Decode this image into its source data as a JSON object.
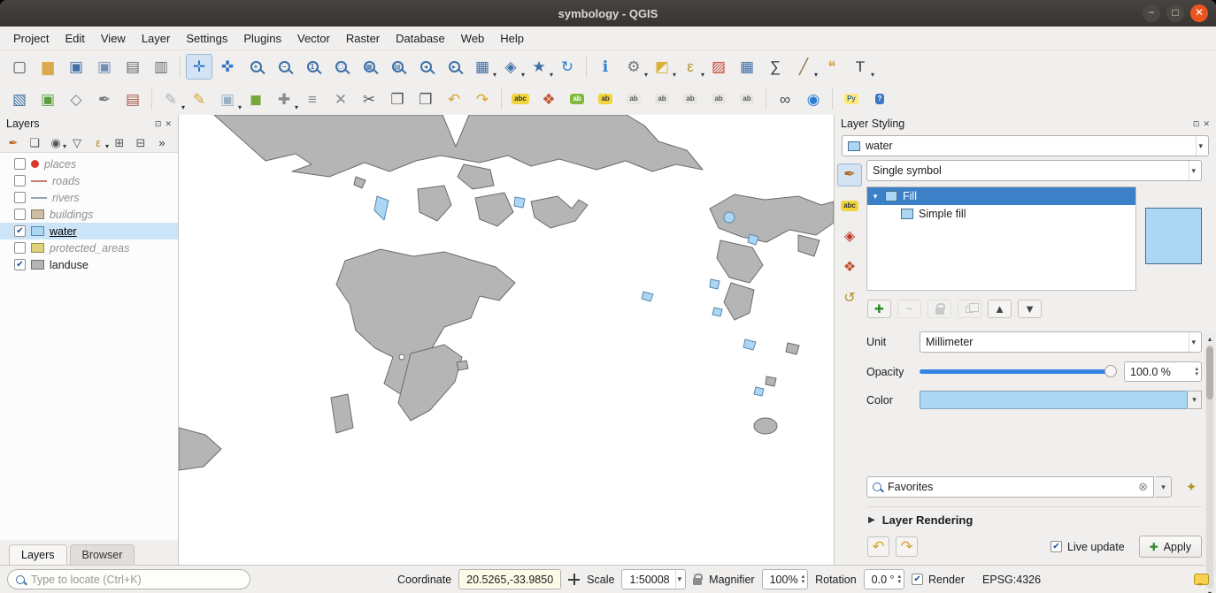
{
  "window": {
    "title": "symbology - QGIS",
    "controls": [
      {
        "type": "minimize",
        "glyph": "−"
      },
      {
        "type": "maximize",
        "glyph": "□"
      },
      {
        "type": "close",
        "glyph": "✕"
      }
    ]
  },
  "glyphs": {
    "dropdown": "▾",
    "spin_up": "▴",
    "spin_down": "▾",
    "check": "✔",
    "float": "⊡",
    "close": "✕",
    "clear": "⊗",
    "collapsed": "▶",
    "tree_expanded": "▾",
    "plus": "✚",
    "overflow": "»"
  },
  "colors": {
    "landuse_fill": "#b5b5b5",
    "landuse_stroke": "#6b6b6b",
    "water_fill": "#abd7f5",
    "water_stroke": "#5c87ab",
    "selection_blue": "#3c80c7"
  },
  "menubar": {
    "items": [
      "Project",
      "Edit",
      "View",
      "Layer",
      "Settings",
      "Plugins",
      "Vector",
      "Raster",
      "Database",
      "Web",
      "Help"
    ]
  },
  "toolbars": {
    "row1": [
      {
        "n": "new-project-button",
        "g": "▢",
        "c": "#4a4a4a"
      },
      {
        "n": "open-project-button",
        "g": "▆",
        "c": "#dba94e"
      },
      {
        "n": "save-project-button",
        "g": "▣",
        "c": "#3f6fa5"
      },
      {
        "n": "save-project-as-button",
        "g": "▣",
        "c": "#6f8fb5"
      },
      {
        "n": "new-print-layout-button",
        "g": "▤",
        "c": "#6a6a6a"
      },
      {
        "n": "show-layout-manager-button",
        "g": "▥",
        "c": "#6a6a6a"
      },
      {
        "t": "sep"
      },
      {
        "n": "pan-map-button",
        "g": "✛",
        "c": "#2f6fc4",
        "on": true
      },
      {
        "n": "pan-to-selection-button",
        "g": "✜",
        "c": "#2f6fc4"
      },
      {
        "n": "zoom-in-button",
        "t": "mag",
        "sub": "+"
      },
      {
        "n": "zoom-out-button",
        "t": "mag",
        "sub": "−"
      },
      {
        "n": "zoom-native-button",
        "t": "mag",
        "sub": "1"
      },
      {
        "n": "zoom-full-button",
        "t": "mag",
        "sub": "□"
      },
      {
        "n": "zoom-to-selection-button",
        "t": "mag",
        "sub": "▦"
      },
      {
        "n": "zoom-to-layer-button",
        "t": "mag",
        "sub": "▤"
      },
      {
        "n": "zoom-last-button",
        "t": "mag",
        "sub": "◂"
      },
      {
        "n": "zoom-next-button",
        "t": "mag",
        "sub": "▸"
      },
      {
        "n": "new-map-view-button",
        "g": "▦",
        "c": "#3f6fa5",
        "dd": true
      },
      {
        "n": "new-3d-map-view-button",
        "g": "◈",
        "c": "#3f6fa5",
        "dd": true
      },
      {
        "n": "show-bookmarks-button",
        "g": "★",
        "c": "#3f6fa5",
        "dd": true
      },
      {
        "n": "refresh-map-button",
        "g": "↻",
        "c": "#2d7dd2"
      },
      {
        "t": "sep"
      },
      {
        "n": "identify-features-button",
        "g": "ℹ",
        "c": "#2d7dd2"
      },
      {
        "n": "run-feature-action-button",
        "g": "⚙",
        "c": "#777777",
        "dd": true
      },
      {
        "n": "select-features-button",
        "g": "◩",
        "c": "#d9b23a",
        "dd": true
      },
      {
        "n": "select-by-expression-button",
        "g": "ε",
        "c": "#b5912c",
        "dd": true
      },
      {
        "n": "deselect-features-button",
        "g": "▨",
        "c": "#c74634"
      },
      {
        "n": "open-attribute-table-button",
        "g": "▦",
        "c": "#3f6fa5"
      },
      {
        "n": "statistical-summary-button",
        "g": "∑",
        "c": "#333333"
      },
      {
        "n": "measure-button",
        "g": "╱",
        "c": "#8a6d3b",
        "dd": true
      },
      {
        "n": "map-tips-button",
        "g": "❝",
        "c": "#d9a441"
      },
      {
        "n": "text-annotation-button",
        "g": "T",
        "c": "#333333",
        "dd": true
      }
    ],
    "row2": [
      {
        "n": "data-source-manager-button",
        "g": "▧",
        "c": "#3f6fa5"
      },
      {
        "n": "new-geopackage-layer-button",
        "g": "▣",
        "c": "#5a9e3c"
      },
      {
        "n": "new-shapefile-layer-button",
        "g": "◇",
        "c": "#7a7a7a"
      },
      {
        "n": "new-spatialite-layer-button",
        "g": "✒",
        "c": "#7a7a7a"
      },
      {
        "n": "new-virtual-layer-button",
        "g": "▤",
        "c": "#a85a4a"
      },
      {
        "t": "sep"
      },
      {
        "n": "current-edits-button",
        "g": "✎",
        "c": "#b0b0b0",
        "dd": true
      },
      {
        "n": "toggle-editing-button",
        "g": "✎",
        "c": "#d9a62e"
      },
      {
        "n": "save-layer-edits-button",
        "g": "▣",
        "c": "#9ab0c4",
        "dd": true
      },
      {
        "n": "add-polygon-feature-button",
        "g": "◼",
        "c": "#76a63c"
      },
      {
        "n": "vertex-tool-button",
        "g": "✚",
        "c": "#8a8a8a",
        "dd": true
      },
      {
        "n": "modify-attributes-button",
        "g": "≡",
        "c": "#8a8a8a"
      },
      {
        "n": "delete-selected-button",
        "g": "✕",
        "c": "#8a8a8a"
      },
      {
        "n": "cut-features-button",
        "g": "✂",
        "c": "#555555"
      },
      {
        "n": "copy-features-button",
        "g": "❐",
        "c": "#555555"
      },
      {
        "n": "paste-features-button",
        "g": "❒",
        "c": "#555555"
      },
      {
        "n": "undo-button",
        "g": "↶",
        "c": "#d9a62e"
      },
      {
        "n": "redo-button",
        "g": "↷",
        "c": "#d9a62e"
      },
      {
        "t": "sep"
      },
      {
        "n": "layer-labeling-button",
        "t": "badge",
        "g": "abc",
        "b": "#f2d43c",
        "c": "#333333"
      },
      {
        "n": "layer-diagram-button",
        "g": "❖",
        "c": "#c0532f"
      },
      {
        "n": "highlight-pinned-labels-button",
        "t": "badge",
        "g": "ab",
        "b": "#7fba3d",
        "c": "#ffffff"
      },
      {
        "n": "change-label-button",
        "t": "badge",
        "g": "ab",
        "b": "#f2d43c",
        "c": "#333333"
      },
      {
        "n": "pin-unpin-labels-button",
        "t": "badge",
        "g": "ab",
        "b": "#e8e6e3",
        "c": "#555555"
      },
      {
        "n": "show-hide-labels-button",
        "t": "badge",
        "g": "ab",
        "b": "#e8e6e3",
        "c": "#555555"
      },
      {
        "n": "move-label-button",
        "t": "badge",
        "g": "ab",
        "b": "#e8e6e3",
        "c": "#555555"
      },
      {
        "n": "rotate-label-button",
        "t": "badge",
        "g": "ab",
        "b": "#e8e6e3",
        "c": "#555555"
      },
      {
        "n": "change-label-properties-button",
        "t": "badge",
        "g": "ab",
        "b": "#e8e6e3",
        "c": "#555555"
      },
      {
        "t": "sep"
      },
      {
        "n": "nominatim-search-button",
        "g": "∞",
        "c": "#444444"
      },
      {
        "n": "metasearch-button",
        "g": "◉",
        "c": "#2d7dd2"
      },
      {
        "t": "sep"
      },
      {
        "n": "python-console-button",
        "t": "badge",
        "g": "Py",
        "b": "#ffe873",
        "c": "#356fa0"
      },
      {
        "n": "help-button",
        "t": "badge",
        "g": "?",
        "b": "#3a77c2",
        "c": "#ffffff"
      }
    ]
  },
  "layers_panel": {
    "title": "Layers",
    "toolbar": [
      {
        "n": "open-layer-styling-panel-button",
        "g": "✒",
        "c": "#b5651d"
      },
      {
        "n": "add-group-button",
        "g": "❏",
        "c": "#555555"
      },
      {
        "n": "manage-map-themes-button",
        "g": "◉",
        "c": "#555555",
        "dd": true
      },
      {
        "n": "filter-legend-button",
        "g": "▽",
        "c": "#555555"
      },
      {
        "n": "filter-by-expression-button",
        "g": "ε",
        "c": "#b5912c",
        "dd": true
      },
      {
        "n": "expand-all-button",
        "g": "⊞",
        "c": "#555555"
      },
      {
        "n": "collapse-all-button",
        "g": "⊟",
        "c": "#555555"
      },
      {
        "n": "toolbar-overflow-button",
        "g": "»",
        "c": "#333333"
      }
    ],
    "items": [
      {
        "label": "places",
        "checked": false,
        "italic": true,
        "selected": false,
        "swatch": {
          "type": "dot",
          "color": "#d63a2f"
        }
      },
      {
        "label": "roads",
        "checked": false,
        "italic": true,
        "selected": false,
        "swatch": {
          "type": "line",
          "color": "#c97b72"
        }
      },
      {
        "label": "rivers",
        "checked": false,
        "italic": true,
        "selected": false,
        "swatch": {
          "type": "line",
          "color": "#94a7b7"
        }
      },
      {
        "label": "buildings",
        "checked": false,
        "italic": true,
        "selected": false,
        "swatch": {
          "type": "rect",
          "color": "#cdbda5",
          "border": "#8a7b63"
        }
      },
      {
        "label": "water",
        "checked": true,
        "italic": false,
        "selected": true,
        "swatch": {
          "type": "rect",
          "color": "#abd7f5",
          "border": "#5c87ab"
        }
      },
      {
        "label": "protected_areas",
        "checked": false,
        "italic": true,
        "selected": false,
        "swatch": {
          "type": "rect",
          "color": "#ded27a",
          "border": "#9a8f4a"
        }
      },
      {
        "label": "landuse",
        "checked": true,
        "italic": false,
        "selected": false,
        "swatch": {
          "type": "rect",
          "color": "#b5b5b5",
          "border": "#6e6e6e"
        }
      }
    ],
    "tabs": [
      "Layers",
      "Browser"
    ]
  },
  "styling_panel": {
    "title": "Layer Styling",
    "layer_combo": {
      "value": "water"
    },
    "renderer_combo": "Single symbol",
    "side_tabs": [
      {
        "n": "symbology-tab-button",
        "g": "✒",
        "c": "#b5651d",
        "on": true
      },
      {
        "n": "labels-tab-button",
        "t": "badge",
        "g": "abc",
        "b": "#f2d43c",
        "c": "#333333"
      },
      {
        "n": "3d-view-tab-button",
        "g": "◈",
        "c": "#c0392b"
      },
      {
        "n": "diagrams-tab-button",
        "g": "❖",
        "c": "#c0532f"
      },
      {
        "n": "history-tab-button",
        "g": "↺",
        "c": "#b5912c"
      }
    ],
    "symbol_tree": {
      "root_label": "Fill",
      "child_label": "Simple fill"
    },
    "symbol_buttons": [
      {
        "n": "add-symbol-layer-button",
        "g": "✚",
        "c": "#2e8b2e"
      },
      {
        "n": "remove-symbol-layer-button",
        "g": "−",
        "c": "#555555",
        "dis": true
      },
      {
        "n": "lock-symbol-layer-button",
        "t": "lock",
        "dis": true
      },
      {
        "n": "duplicate-symbol-layer-button",
        "t": "dup",
        "dis": true
      },
      {
        "n": "move-symbol-up-button",
        "g": "▲",
        "c": "#444444"
      },
      {
        "n": "move-symbol-down-button",
        "g": "▼",
        "c": "#444444"
      }
    ],
    "properties": {
      "unit_label": "Unit",
      "unit_value": "Millimeter",
      "opacity_label": "Opacity",
      "opacity_value": "100.0 %",
      "color_label": "Color"
    },
    "favorites": {
      "value": "Favorites"
    },
    "layer_rendering": {
      "label": "Layer Rendering"
    },
    "footer": {
      "history_buttons": [
        {
          "n": "style-undo-button",
          "g": "↶",
          "c": "#d9a62e"
        },
        {
          "n": "style-redo-button",
          "g": "↷",
          "c": "#d9a62e"
        }
      ],
      "live_update_label": "Live update",
      "apply_label": "Apply"
    }
  },
  "statusbar": {
    "locate_placeholder": "Type to locate (Ctrl+K)",
    "coordinate_label": "Coordinate",
    "coordinate_value": "20.5265,-33.9850",
    "scale_label": "Scale",
    "scale_value": "1:50008",
    "magnifier_label": "Magnifier",
    "magnifier_value": "100%",
    "rotation_label": "Rotation",
    "rotation_value": "0.0 °",
    "render_label": "Render",
    "crs_label": "EPSG:4326"
  }
}
